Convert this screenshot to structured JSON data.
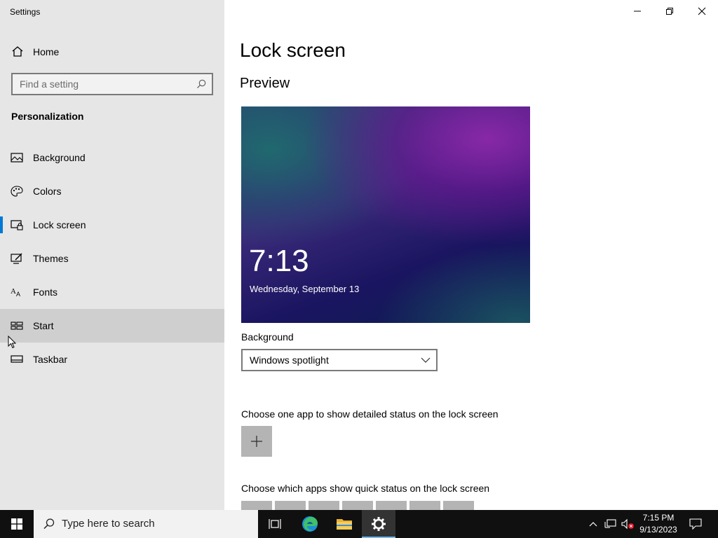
{
  "app": {
    "title": "Settings"
  },
  "sidebar": {
    "home_label": "Home",
    "search_placeholder": "Find a setting",
    "section_title": "Personalization",
    "items": [
      {
        "label": "Background",
        "icon": "picture-icon"
      },
      {
        "label": "Colors",
        "icon": "palette-icon"
      },
      {
        "label": "Lock screen",
        "icon": "lock-screen-icon",
        "selected": true
      },
      {
        "label": "Themes",
        "icon": "themes-icon"
      },
      {
        "label": "Fonts",
        "icon": "fonts-icon"
      },
      {
        "label": "Start",
        "icon": "start-icon",
        "hovered": true
      },
      {
        "label": "Taskbar",
        "icon": "taskbar-icon"
      }
    ]
  },
  "main": {
    "title": "Lock screen",
    "preview_heading": "Preview",
    "preview": {
      "time": "7:13",
      "date": "Wednesday, September 13"
    },
    "background_label": "Background",
    "background_value": "Windows spotlight",
    "detail_status_label": "Choose one app to show detailed status on the lock screen",
    "quick_status_label": "Choose which apps show quick status on the lock screen"
  },
  "taskbar": {
    "search_text": "Type here to search",
    "clock_time": "7:15 PM",
    "clock_date": "9/13/2023"
  },
  "colors": {
    "accent": "#0078d4",
    "sidebar_bg": "#e6e6e6",
    "taskbar_bg": "#101010"
  }
}
